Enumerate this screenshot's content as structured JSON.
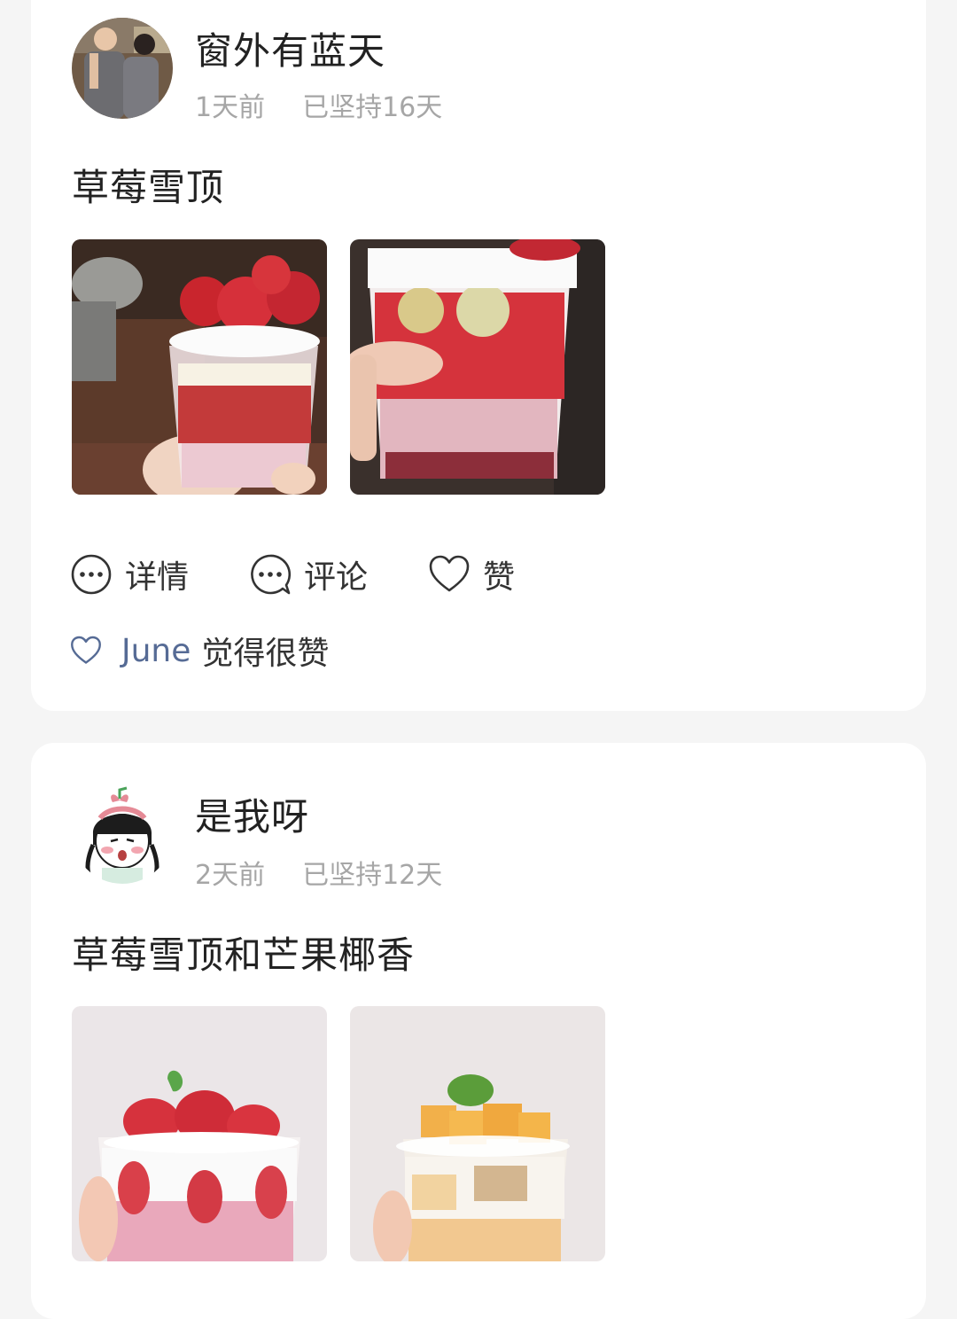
{
  "posts": [
    {
      "username": "窗外有蓝天",
      "time_ago": "1天前",
      "streak": "已坚持16天",
      "text": "草莓雪顶",
      "actions": {
        "detail": "详情",
        "comment": "评论",
        "like": "赞"
      },
      "liked_by": {
        "name": "June",
        "suffix": "觉得很赞"
      }
    },
    {
      "username": "是我呀",
      "time_ago": "2天前",
      "streak": "已坚持12天",
      "text": "草莓雪顶和芒果椰香"
    }
  ],
  "colors": {
    "background": "#f5f5f5",
    "card": "#ffffff",
    "liker_link": "#566b95",
    "meta_gray": "#a6a6a6"
  }
}
